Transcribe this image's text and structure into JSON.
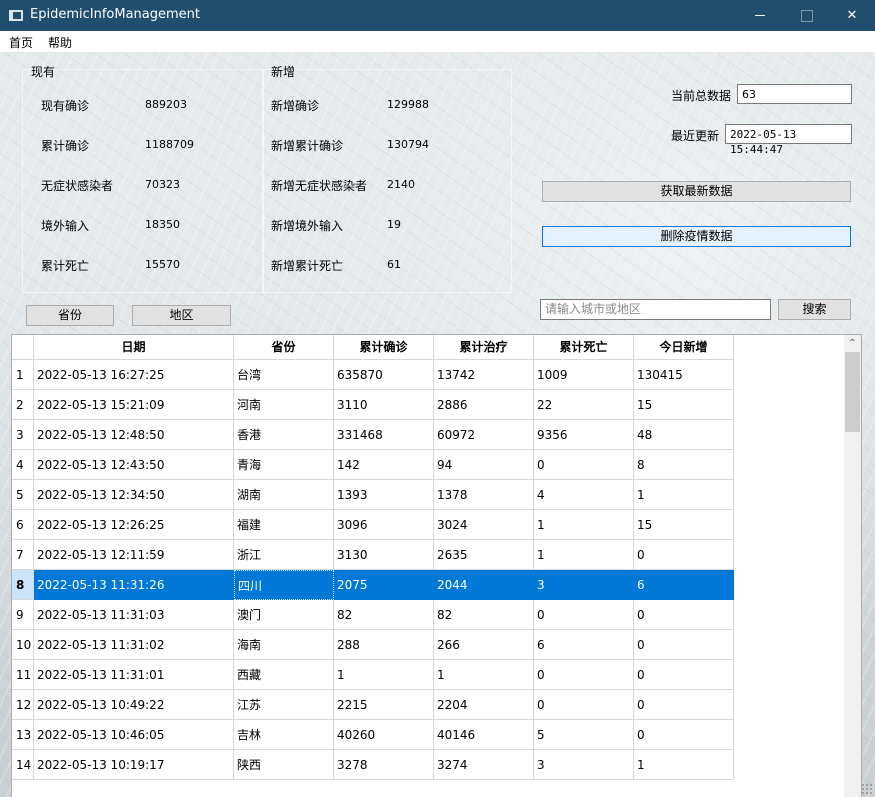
{
  "window": {
    "title": "EpidemicInfoManagement",
    "close_glyph": "✕"
  },
  "menu": {
    "home": "首页",
    "help": "帮助"
  },
  "existing": {
    "title": "现有",
    "items": [
      {
        "label": "现有确诊",
        "value": "889203"
      },
      {
        "label": "累计确诊",
        "value": "1188709"
      },
      {
        "label": "无症状感染者",
        "value": "70323"
      },
      {
        "label": "境外输入",
        "value": "18350"
      },
      {
        "label": "累计死亡",
        "value": "15570"
      }
    ]
  },
  "new": {
    "title": "新增",
    "items": [
      {
        "label": "新增确诊",
        "value": "129988"
      },
      {
        "label": "新增累计确诊",
        "value": "130794"
      },
      {
        "label": "新增无症状感染者",
        "value": "2140"
      },
      {
        "label": "新增境外输入",
        "value": "19"
      },
      {
        "label": "新增累计死亡",
        "value": "61"
      }
    ]
  },
  "info": {
    "total_label": "当前总数据",
    "total_value": "63",
    "updated_label": "最近更新",
    "updated_value": "2022-05-13 15:44:47"
  },
  "actions": {
    "fetch_label": "获取最新数据",
    "delete_label": "删除疫情数据",
    "province_label": "省份",
    "region_label": "地区",
    "search_placeholder": "请输入城市或地区",
    "search_label": "搜索"
  },
  "table": {
    "columns": [
      "日期",
      "省份",
      "累计确诊",
      "累计治疗",
      "累计死亡",
      "今日新增"
    ],
    "selected_row": 8,
    "rows": [
      {
        "n": "1",
        "cells": [
          "2022-05-13 16:27:25",
          "台湾",
          "635870",
          "13742",
          "1009",
          "130415"
        ]
      },
      {
        "n": "2",
        "cells": [
          "2022-05-13 15:21:09",
          "河南",
          "3110",
          "2886",
          "22",
          "15"
        ]
      },
      {
        "n": "3",
        "cells": [
          "2022-05-13 12:48:50",
          "香港",
          "331468",
          "60972",
          "9356",
          "48"
        ]
      },
      {
        "n": "4",
        "cells": [
          "2022-05-13 12:43:50",
          "青海",
          "142",
          "94",
          "0",
          "8"
        ]
      },
      {
        "n": "5",
        "cells": [
          "2022-05-13 12:34:50",
          "湖南",
          "1393",
          "1378",
          "4",
          "1"
        ]
      },
      {
        "n": "6",
        "cells": [
          "2022-05-13 12:26:25",
          "福建",
          "3096",
          "3024",
          "1",
          "15"
        ]
      },
      {
        "n": "7",
        "cells": [
          "2022-05-13 12:11:59",
          "浙江",
          "3130",
          "2635",
          "1",
          "0"
        ]
      },
      {
        "n": "8",
        "cells": [
          "2022-05-13 11:31:26",
          "四川",
          "2075",
          "2044",
          "3",
          "6"
        ]
      },
      {
        "n": "9",
        "cells": [
          "2022-05-13 11:31:03",
          "澳门",
          "82",
          "82",
          "0",
          "0"
        ]
      },
      {
        "n": "10",
        "cells": [
          "2022-05-13 11:31:02",
          "海南",
          "288",
          "266",
          "6",
          "0"
        ]
      },
      {
        "n": "11",
        "cells": [
          "2022-05-13 11:31:01",
          "西藏",
          "1",
          "1",
          "0",
          "0"
        ]
      },
      {
        "n": "12",
        "cells": [
          "2022-05-13 10:49:22",
          "江苏",
          "2215",
          "2204",
          "0",
          "0"
        ]
      },
      {
        "n": "13",
        "cells": [
          "2022-05-13 10:46:05",
          "吉林",
          "40260",
          "40146",
          "5",
          "0"
        ]
      },
      {
        "n": "14",
        "cells": [
          "2022-05-13 10:19:17",
          "陕西",
          "3278",
          "3274",
          "3",
          "1"
        ]
      }
    ]
  },
  "scroll": {
    "up": "⌃",
    "down": "⌄"
  }
}
